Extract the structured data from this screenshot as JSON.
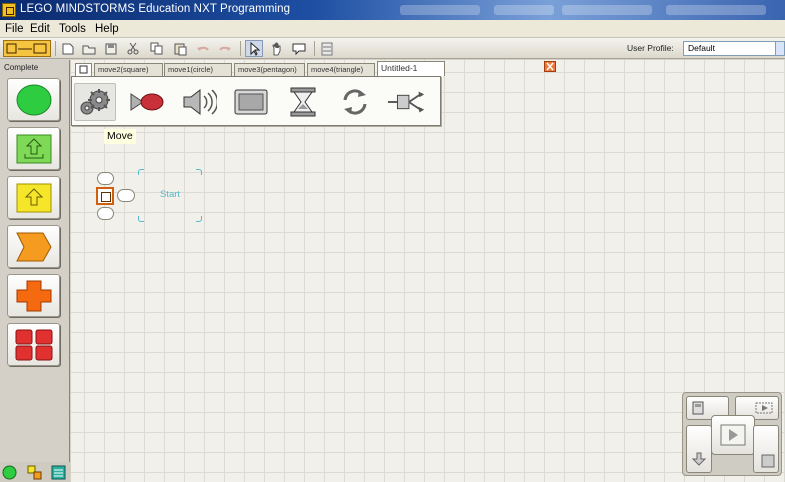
{
  "window": {
    "title": "LEGO MINDSTORMS Education NXT Programming"
  },
  "menu": {
    "items": [
      "File",
      "Edit",
      "Tools",
      "Help"
    ]
  },
  "toolbar": {
    "profile_label": "User Profile:",
    "profile_value": "Default"
  },
  "palette": {
    "label": "Complete",
    "buttons": [
      {
        "name": "common-palette-button",
        "color": "#2ecc40",
        "icon": "green-circle-icon"
      },
      {
        "name": "action-palette-button",
        "color": "#7ed957",
        "icon": "upload-arrow-icon"
      },
      {
        "name": "sensor-palette-button",
        "color": "#f5e62a",
        "icon": "up-arrow-icon"
      },
      {
        "name": "flow-palette-button",
        "color": "#f59b20",
        "icon": "pentagon-arrow-icon"
      },
      {
        "name": "data-palette-button",
        "color": "#f56a10",
        "icon": "plus-cross-icon"
      },
      {
        "name": "advanced-palette-button",
        "color": "#e03030",
        "icon": "grid-icon"
      }
    ]
  },
  "tabs": [
    {
      "label": "move2(square)"
    },
    {
      "label": "move1(circle)"
    },
    {
      "label": "move3(pentagon)"
    },
    {
      "label": "move4(triangle)"
    },
    {
      "label": "Untitled-1",
      "active": true
    }
  ],
  "subpalette": {
    "items": [
      {
        "name": "move-block",
        "icon": "gear-icon"
      },
      {
        "name": "record-play-block",
        "icon": "record-icon"
      },
      {
        "name": "sound-block",
        "icon": "speaker-icon"
      },
      {
        "name": "display-block",
        "icon": "display-icon"
      },
      {
        "name": "wait-block",
        "icon": "hourglass-icon"
      },
      {
        "name": "loop-block",
        "icon": "loop-icon"
      },
      {
        "name": "switch-block",
        "icon": "switch-icon"
      }
    ],
    "tooltip": "Move"
  },
  "canvas": {
    "drop_label": "Start"
  }
}
